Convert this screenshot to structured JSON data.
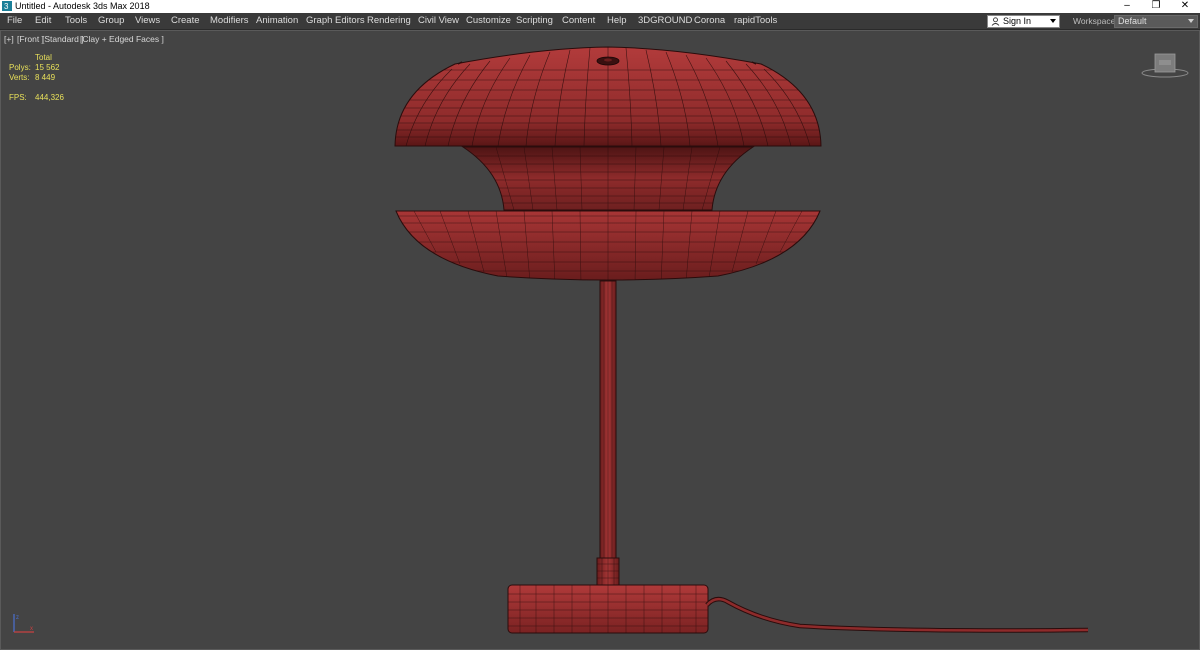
{
  "window": {
    "title": "Untitled - Autodesk 3ds Max 2018",
    "controls": {
      "minimize": "–",
      "restore": "❐",
      "close": "✕"
    }
  },
  "menu": {
    "items": [
      "File",
      "Edit",
      "Tools",
      "Group",
      "Views",
      "Create",
      "Modifiers",
      "Animation",
      "Graph Editors",
      "Rendering",
      "Civil View",
      "Customize",
      "Scripting",
      "Content",
      "Help",
      "3DGROUND",
      "Corona",
      "rapidTools"
    ]
  },
  "account": {
    "sign_in": "Sign In"
  },
  "workspaces": {
    "label": "Workspaces:",
    "value": "Default"
  },
  "viewport": {
    "labels": [
      "[+]",
      "[Front ]",
      "[Standard ]",
      "[Clay + Edged Faces ]"
    ],
    "stats": {
      "header": "Total",
      "polys_label": "Polys:",
      "polys_value": "15 562",
      "verts_label": "Verts:",
      "verts_value": "8 449",
      "fps_label": "FPS:",
      "fps_value": "444,326"
    }
  },
  "colors": {
    "model": "#8e2b2b",
    "model_dark": "#5a1616",
    "wire": "#2a0c0c",
    "background": "#444444",
    "stats_text": "#e8e05a"
  }
}
